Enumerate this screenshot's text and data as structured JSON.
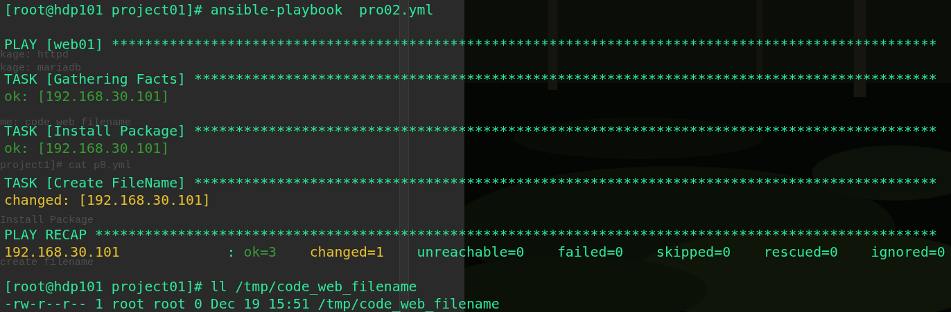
{
  "background_window": {
    "lines": [
      "kage: httpd",
      "kage: mariadb",
      "me: code web filename",
      "project1]# cat p8.yml",
      "Install Package",
      "create filename"
    ]
  },
  "terminal": {
    "lines": [
      {
        "kind": "text",
        "segments": [
          {
            "kind": "normal",
            "text": "[root@hdp101 project01]# ansible-playbook  pro02.yml"
          }
        ]
      },
      {
        "kind": "blank"
      },
      {
        "kind": "text",
        "segments": [
          {
            "kind": "normal",
            "text": "PLAY [web01] ****************************************************************************************************"
          }
        ]
      },
      {
        "kind": "blank"
      },
      {
        "kind": "text",
        "segments": [
          {
            "kind": "normal",
            "text": "TASK [Gathering Facts] ******************************************************************************************"
          }
        ]
      },
      {
        "kind": "text",
        "segments": [
          {
            "kind": "ok",
            "text": "ok: [192.168.30.101]"
          }
        ]
      },
      {
        "kind": "blank"
      },
      {
        "kind": "text",
        "segments": [
          {
            "kind": "normal",
            "text": "TASK [Install Package] ******************************************************************************************"
          }
        ]
      },
      {
        "kind": "text",
        "segments": [
          {
            "kind": "ok",
            "text": "ok: [192.168.30.101]"
          }
        ]
      },
      {
        "kind": "blank"
      },
      {
        "kind": "text",
        "segments": [
          {
            "kind": "normal",
            "text": "TASK [Create FileName] ******************************************************************************************"
          }
        ]
      },
      {
        "kind": "text",
        "segments": [
          {
            "kind": "changed",
            "text": "changed: [192.168.30.101]"
          }
        ]
      },
      {
        "kind": "blank"
      },
      {
        "kind": "text",
        "segments": [
          {
            "kind": "normal",
            "text": "PLAY RECAP ******************************************************************************************************"
          }
        ]
      },
      {
        "kind": "text",
        "segments": [
          {
            "kind": "changed",
            "text": "192.168.30.101"
          },
          {
            "kind": "normal",
            "text": "             : "
          },
          {
            "kind": "ok",
            "text": "ok=3    "
          },
          {
            "kind": "changed",
            "text": "changed=1"
          },
          {
            "kind": "normal",
            "text": "    unreachable=0    failed=0    skipped=0    rescued=0    ignored=0"
          }
        ]
      },
      {
        "kind": "blank"
      },
      {
        "kind": "text",
        "segments": [
          {
            "kind": "normal",
            "text": "[root@hdp101 project01]# ll /tmp/code_web_filename"
          }
        ]
      },
      {
        "kind": "text",
        "segments": [
          {
            "kind": "normal",
            "text": "-rw-r--r-- 1 root root 0 Dec 19 15:51 /tmp/code_web_filename"
          }
        ]
      }
    ]
  }
}
